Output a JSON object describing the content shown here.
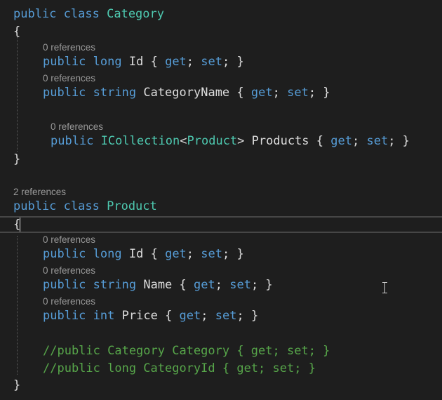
{
  "editor": {
    "category_class": {
      "decl": {
        "kw1": "public",
        "kw2": "class",
        "name": "Category"
      },
      "open_brace": "{",
      "close_brace": "}",
      "members": [
        {
          "lens": "0 references",
          "kw": "public",
          "type": "long",
          "name": "Id",
          "accessors": [
            "get",
            "set"
          ]
        },
        {
          "lens": "0 references",
          "kw": "public",
          "type": "string",
          "name": "CategoryName",
          "accessors": [
            "get",
            "set"
          ]
        },
        {
          "lens": "0 references",
          "kw": "public",
          "type_generic": "ICollection",
          "type_arg": "Product",
          "name": "Products",
          "accessors": [
            "get",
            "set"
          ]
        }
      ]
    },
    "product_class": {
      "lens": "2 references",
      "decl": {
        "kw1": "public",
        "kw2": "class",
        "name": "Product"
      },
      "open_brace": "{",
      "close_brace": "}",
      "members": [
        {
          "lens": "0 references",
          "kw": "public",
          "type": "long",
          "name": "Id",
          "accessors": [
            "get",
            "set"
          ]
        },
        {
          "lens": "0 references",
          "kw": "public",
          "type": "string",
          "name": "Name",
          "accessors": [
            "get",
            "set"
          ]
        },
        {
          "lens": "0 references",
          "kw": "public",
          "type": "int",
          "name": "Price",
          "accessors": [
            "get",
            "set"
          ]
        }
      ],
      "comments": [
        "//public Category Category { get; set; }",
        "//public long CategoryId { get; set; }"
      ]
    }
  },
  "colors": {
    "background": "#1e1e1e",
    "keyword": "#569cd6",
    "type": "#4ec9b0",
    "comment": "#57a64a",
    "text": "#dcdcdc",
    "codelens": "#999999"
  }
}
